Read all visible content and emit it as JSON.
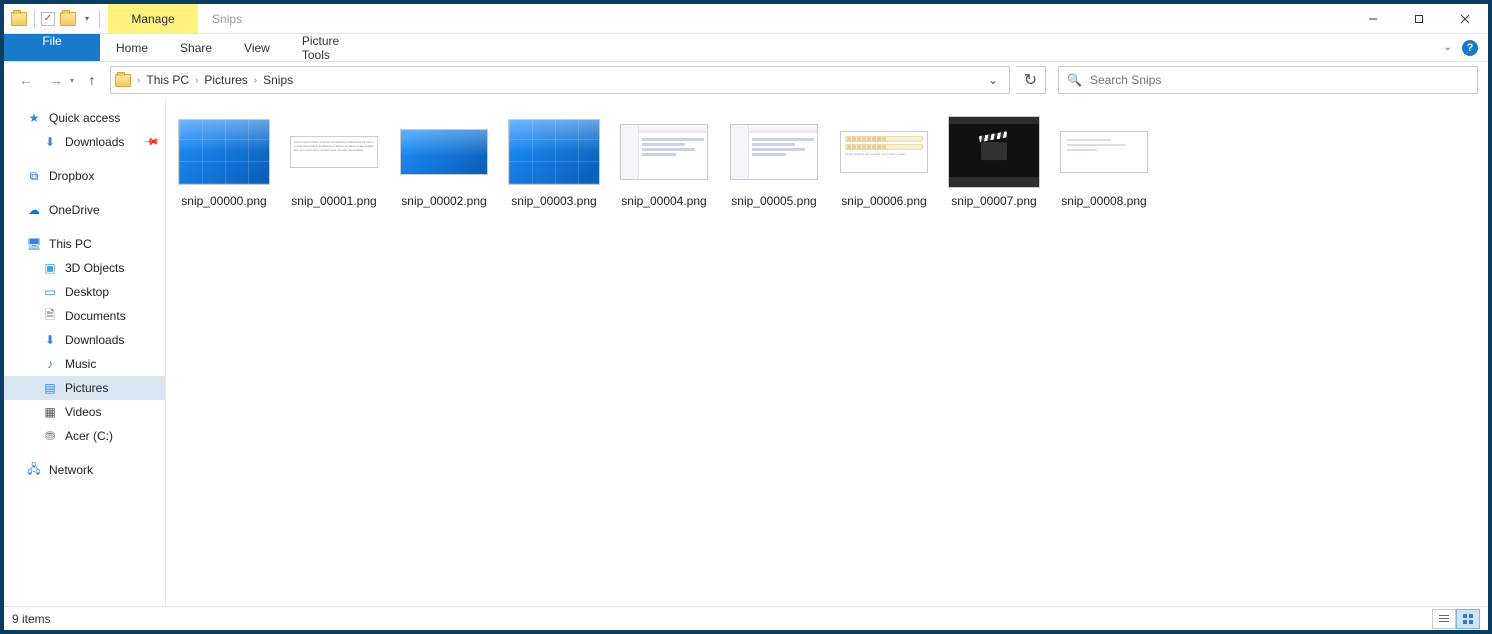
{
  "window": {
    "manage_label": "Manage",
    "title": "Snips"
  },
  "ribbon": {
    "file": "File",
    "home": "Home",
    "share": "Share",
    "view": "View",
    "picture_tools": "Picture Tools"
  },
  "breadcrumb": {
    "root": "This PC",
    "lib": "Pictures",
    "folder": "Snips"
  },
  "search": {
    "placeholder": "Search Snips"
  },
  "sidebar": {
    "quick_access": "Quick access",
    "downloads": "Downloads",
    "dropbox": "Dropbox",
    "onedrive": "OneDrive",
    "this_pc": "This PC",
    "objects3d": "3D Objects",
    "desktop": "Desktop",
    "documents": "Documents",
    "downloads2": "Downloads",
    "music": "Music",
    "pictures": "Pictures",
    "videos": "Videos",
    "acer": "Acer (C:)",
    "network": "Network"
  },
  "files": [
    {
      "name": "snip_00000.png",
      "kind": "desktop-big"
    },
    {
      "name": "snip_00001.png",
      "kind": "text"
    },
    {
      "name": "snip_00002.png",
      "kind": "desktop-small"
    },
    {
      "name": "snip_00003.png",
      "kind": "desktop-big"
    },
    {
      "name": "snip_00004.png",
      "kind": "app"
    },
    {
      "name": "snip_00005.png",
      "kind": "app"
    },
    {
      "name": "snip_00006.png",
      "kind": "toolbar"
    },
    {
      "name": "snip_00007.png",
      "kind": "player"
    },
    {
      "name": "snip_00008.png",
      "kind": "lines"
    }
  ],
  "status": {
    "count": "9 items"
  }
}
